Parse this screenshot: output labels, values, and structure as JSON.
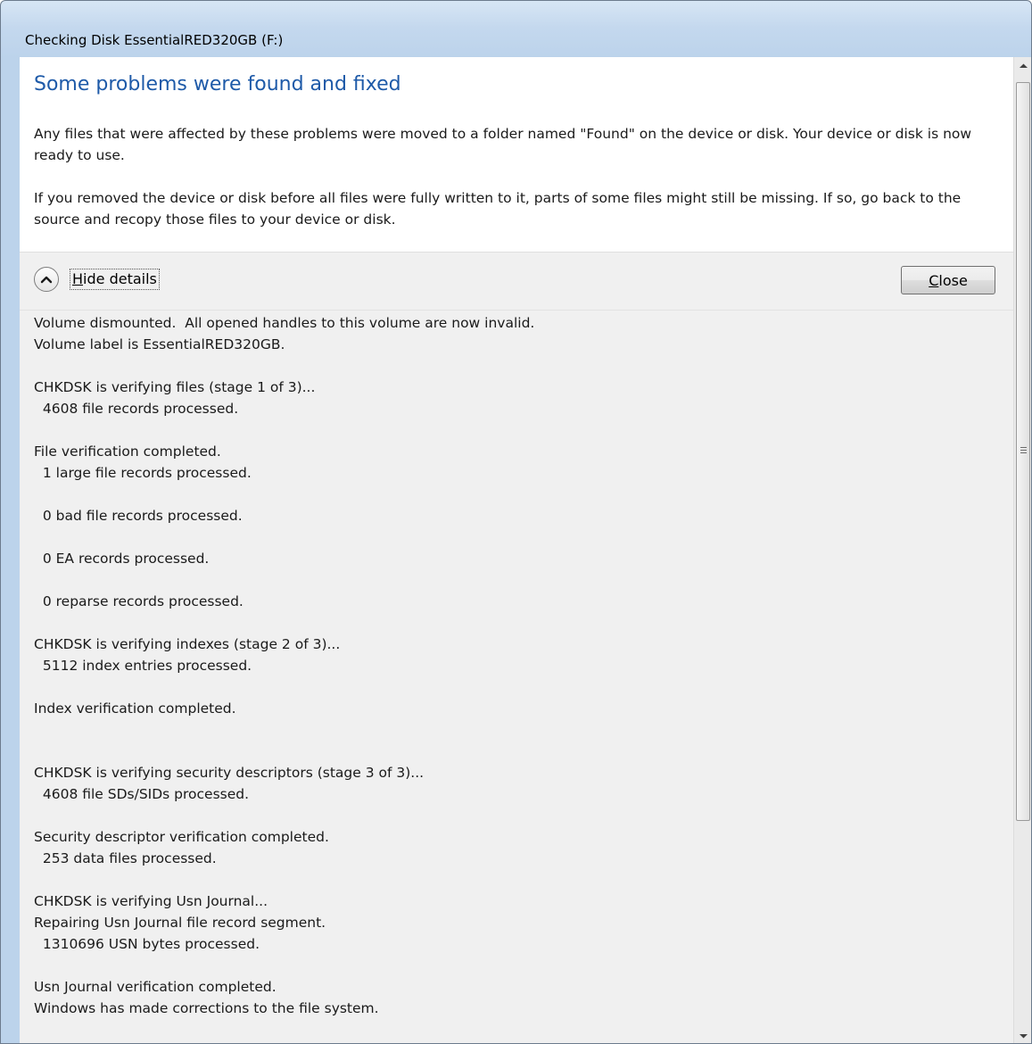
{
  "window": {
    "title": "Checking Disk EssentialRED320GB (F:)"
  },
  "header": {
    "heading": "Some problems were found and fixed",
    "paragraph1": "Any files that were affected by these problems were moved to a folder named \"Found\" on the device or disk. Your device or disk is now ready to use.",
    "paragraph2": "If you removed the device or disk before all files were fully written to it, parts of some files might still be missing. If so, go back to the source and recopy those files to your device or disk."
  },
  "details": {
    "toggle_label": "Hide details",
    "toggle_icon": "chevron-up-icon",
    "close_label": "Close"
  },
  "log": {
    "lines": [
      "Volume dismounted.  All opened handles to this volume are now invalid.",
      "Volume label is EssentialRED320GB.",
      "CHKDSK is verifying files (stage 1 of 3)...",
      "  4608 file records processed.",
      "File verification completed.",
      "  1 large file records processed.",
      "  0 bad file records processed.",
      "  0 EA records processed.",
      "  0 reparse records processed.",
      "CHKDSK is verifying indexes (stage 2 of 3)...",
      "  5112 index entries processed.",
      "Index verification completed.",
      "CHKDSK is verifying security descriptors (stage 3 of 3)...",
      "  4608 file SDs/SIDs processed.",
      "Security descriptor verification completed.",
      "  253 data files processed.",
      "CHKDSK is verifying Usn Journal...",
      "Repairing Usn Journal file record segment.",
      "  1310696 USN bytes processed.",
      "Usn Journal verification completed.",
      "Windows has made corrections to the file system."
    ]
  },
  "colors": {
    "heading": "#1e5aa8",
    "titlebar": "#c4d8ee",
    "details_background": "#f0f0f0"
  }
}
